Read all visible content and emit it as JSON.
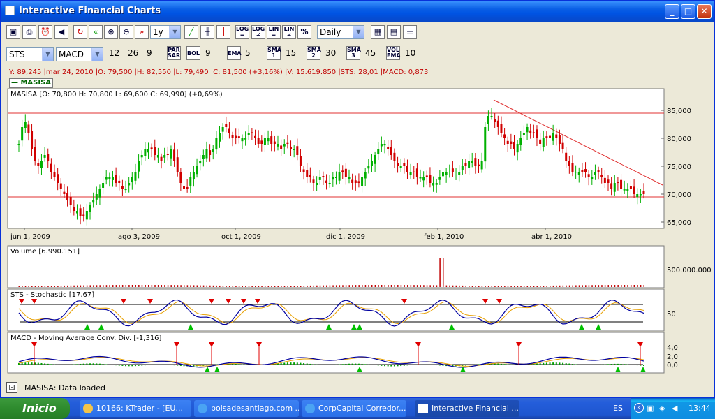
{
  "window": {
    "title": "Interactive Financial Charts"
  },
  "toolbar1": {
    "period_value": "1y",
    "interval_value": "Daily",
    "log_buttons": [
      "LOG =",
      "LOG ≠",
      "LIN =",
      "LIN ≠",
      "%"
    ]
  },
  "toolbar2": {
    "indicator1": "STS",
    "indicator2": "MACD",
    "macd_params": [
      "12",
      "26",
      "9"
    ],
    "par_sar": "PAR SAR",
    "bol": "BOL",
    "bol_val": "9",
    "ema": "EMA",
    "ema_val": "5",
    "sma1": "SMA 1",
    "sma1_val": "15",
    "sma2": "SMA 2",
    "sma2_val": "30",
    "sma3": "SMA 3",
    "sma3_val": "45",
    "volema": "VOL EMA",
    "volema_val": "10"
  },
  "info_line": "Y: 89,245 |mar 24, 2010 |O: 79,500 |H: 82,550 |L: 79,490 |C: 81,500 (+3,16%) |V: 15.619.850 |STS: 28,01 |MACD: 0,873",
  "legend": "MASISA",
  "price_panel": {
    "header": "MASISA [O: 70,800  H: 70,800  L: 69,600  C: 69,990] (+0,69%)",
    "y_ticks": [
      "85,000",
      "80,000",
      "75,000",
      "70,000",
      "65,000"
    ],
    "x_ticks": [
      "jun 1, 2009",
      "ago 3, 2009",
      "oct 1, 2009",
      "dic 1, 2009",
      "feb 1, 2010",
      "abr 1, 2010"
    ]
  },
  "volume_panel": {
    "header": "Volume [6.990.151]",
    "y_ticks": [
      "500.000.000"
    ]
  },
  "sts_panel": {
    "header": "STS - Stochastic [17,67]",
    "y_ticks": [
      "50"
    ]
  },
  "macd_panel": {
    "header": "MACD - Moving Average Conv. Div. [-1,316]",
    "y_ticks": [
      "4,0",
      "2,0",
      "0,0"
    ]
  },
  "status": "MASISA: Data loaded",
  "taskbar": {
    "start": "Inicio",
    "tasks": [
      "10166: KTrader - [EU...",
      "bolsadesantiago.com ...",
      "CorpCapital Corredor...",
      "Interactive Financial ..."
    ],
    "lang": "ES",
    "clock": "13:44"
  },
  "colors": {
    "up": "#00B000",
    "down": "#D00000",
    "resistance": "#E03030",
    "sts_k": "#0000A0",
    "sts_d": "#E8A000"
  },
  "chart_data": {
    "type": "candlestick",
    "ylim": [
      64,
      88
    ],
    "x_count": 260,
    "trendline_desc": "descending resistance from Mar 2010 peak",
    "horizontal_levels": [
      84.5,
      69.5
    ],
    "close_series_approx": [
      79,
      82,
      83,
      81,
      78,
      76,
      75,
      76,
      77,
      76,
      74,
      73,
      72,
      71,
      70,
      69,
      68,
      67,
      67,
      66,
      66,
      67,
      68,
      69,
      70,
      71,
      72,
      73,
      73,
      73,
      72,
      72,
      71,
      71,
      72,
      73,
      74,
      76,
      77,
      78,
      78,
      78,
      77,
      77,
      76,
      77,
      77,
      78,
      76,
      74,
      72,
      71,
      71,
      73,
      74,
      75,
      76,
      77,
      78,
      77,
      78,
      80,
      81,
      82,
      82,
      81,
      80,
      80,
      80,
      80,
      80,
      81,
      81,
      80,
      79,
      79,
      80,
      80,
      79,
      79,
      79,
      78,
      79,
      79,
      78,
      78,
      77,
      75,
      74,
      73,
      73,
      72,
      72,
      73,
      73,
      72,
      72,
      73,
      73,
      74,
      74,
      73,
      73,
      72,
      72,
      72,
      73,
      74,
      75,
      76,
      77,
      78,
      79,
      79,
      78,
      77,
      76,
      75,
      75,
      75,
      74,
      74,
      74,
      73,
      73,
      73,
      73,
      72,
      72,
      72,
      73,
      74,
      74,
      74,
      74,
      74,
      74,
      75,
      75,
      76,
      76,
      75,
      75,
      76,
      82,
      84,
      84,
      83,
      82,
      81,
      80,
      79,
      79,
      78,
      79,
      80,
      81,
      82,
      81,
      81,
      80,
      79,
      80,
      80,
      80,
      81,
      80,
      79,
      78,
      76,
      75,
      74,
      74,
      74,
      74,
      74,
      73,
      73,
      74,
      74,
      73,
      72,
      72,
      71,
      72,
      72,
      71,
      71,
      71,
      71,
      70,
      70,
      70,
      70
    ]
  }
}
